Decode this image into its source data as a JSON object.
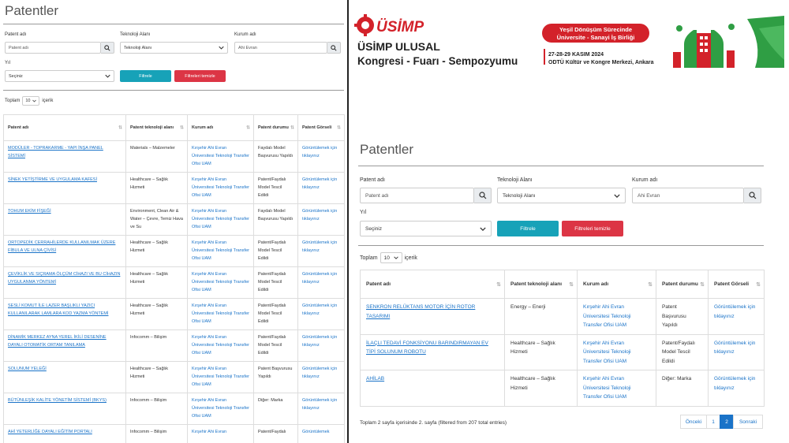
{
  "page": {
    "title": "Patentler"
  },
  "filters": {
    "patent_label": "Patent adı",
    "patent_placeholder": "Patent adı",
    "tech_label": "Teknoloji Alanı",
    "tech_value": "Teknoloji Alanı",
    "kurum_label": "Kurum adı",
    "kurum_value": "Ahi Evran",
    "year_label": "Yıl",
    "year_value": "Seçiniz",
    "filter_button": "Filtrele",
    "clear_button": "Filtreleri temizle"
  },
  "toplam": {
    "prefix": "Toplam",
    "value": "10",
    "suffix": "içerik"
  },
  "table": {
    "headers": [
      "Patent adı",
      "Patent teknoloji alanı",
      "Kurum adı",
      "Patent durumu",
      "Patent Görseli"
    ]
  },
  "left_rows": [
    {
      "name": "MODÜLER - TOPRAKARME - YAPI İNŞA PANEL SİSTEMİ",
      "tech": "Materials – Malzemeler",
      "org": "Kırşehir Ahi Evran Üniversitesi Teknoloji Transfer Ofisi UAM",
      "status": "Faydalı Model Başvurusu Yapıldı",
      "image": "Görüntülemek için tıklayınız"
    },
    {
      "name": "SİNEK YETİŞTİRME VE UYGULAMA KAFESİ",
      "tech": "Healthcare – Sağlık Hizmeti",
      "org": "Kırşehir Ahi Evran Üniversitesi Teknoloji Transfer Ofisi UAM",
      "status": "Patent/Faydalı Model Tescil Edildi",
      "image": "Görüntülemek için tıklayınız"
    },
    {
      "name": "TOHUM EKİM FİŞEĞİ",
      "tech": "Environment, Clean Air & Water – Çevre, Temiz Hava ve Su",
      "org": "Kırşehir Ahi Evran Üniversitesi Teknoloji Transfer Ofisi UAM",
      "status": "Faydalı Model Başvurusu Yapıldı",
      "image": "Görüntülemek için tıklayınız"
    },
    {
      "name": "ORTOPEDİK CERRAHİLERDE KULLANILMAK ÜZERE FİBULA VE ULNA ÇİVİSİ",
      "tech": "Healthcare – Sağlık Hizmeti",
      "org": "Kırşehir Ahi Evran Üniversitesi Teknoloji Transfer Ofisi UAM",
      "status": "Patent/Faydalı Model Tescil Edildi",
      "image": "Görüntülemek için tıklayınız"
    },
    {
      "name": "ÇEVİKLİK VE SIÇRAMA ÖLÇÜM CİHAZI VE BU CİHAZIN UYGULANMA YÖNTEMİ",
      "tech": "Healthcare – Sağlık Hizmeti",
      "org": "Kırşehir Ahi Evran Üniversitesi Teknoloji Transfer Ofisi UAM",
      "status": "Patent/Faydalı Model Tescil Edildi",
      "image": "Görüntülemek için tıklayınız"
    },
    {
      "name": "SESLİ KOMUT İLE LAZER BAŞLIKLI YAZICI KULLANILARAK LAMLARA KOD YAZMA YÖNTEMİ",
      "tech": "Healthcare – Sağlık Hizmeti",
      "org": "Kırşehir Ahi Evran Üniversitesi Teknoloji Transfer Ofisi UAM",
      "status": "Patent/Faydalı Model Tescil Edildi",
      "image": "Görüntülemek için tıklayınız"
    },
    {
      "name": "DİNAMİK MERKEZ AYNA YEREL İKİLİ DESENİNE DAYALI OTOMATİK ORTAM TANILAMA",
      "tech": "Infocomm – Bilişim",
      "org": "Kırşehir Ahi Evran Üniversitesi Teknoloji Transfer Ofisi UAM",
      "status": "Patent/Faydalı Model Tescil Edildi",
      "image": "Görüntülemek için tıklayınız"
    },
    {
      "name": "SOLUNUM YELEĞİ",
      "tech": "Healthcare – Sağlık Hizmeti",
      "org": "Kırşehir Ahi Evran Üniversitesi Teknoloji Transfer Ofisi UAM",
      "status": "Patent Başvurusu Yapıldı",
      "image": "Görüntülemek için tıklayınız"
    },
    {
      "name": "BÜTÜNLEŞİK KALİTE YÖNETİM SİSTEMİ (BKYS)",
      "tech": "Infocomm – Bilişim",
      "org": "Kırşehir Ahi Evran Üniversitesi Teknoloji Transfer Ofisi UAM",
      "status": "Diğer: Marka",
      "image": "Görüntülemek için tıklayınız"
    },
    {
      "name": "AHİ YETERLİĞE DAYALI EĞİTİM PORTALI",
      "tech": "Infocomm – Bilişim",
      "org": "Kırşehir Ahi Evran",
      "status": "Patent/Faydalı",
      "image": "Görüntülemek"
    }
  ],
  "right_rows": [
    {
      "name": "SENKRON RELÜKTANS MOTOR İÇİN ROTOR TASARIMI",
      "tech": "Energy – Enerji",
      "org": "Kırşehir Ahi Evran Üniversitesi Teknoloji Transfer Ofisi UAM",
      "status": "Patent Başvurusu Yapıldı",
      "image": "Görüntülemek için tıklayınız"
    },
    {
      "name": "İLAÇLI TEDAVİ FONKSİYONU BARINDIRMAYAN EV TİPİ SOLUNUM ROBOTU",
      "tech": "Healthcare – Sağlık Hizmeti",
      "org": "Kırşehir Ahi Evran Üniversitesi Teknoloji Transfer Ofisi UAM",
      "status": "Patent/Faydalı Model Tescil Edildi",
      "image": "Görüntülemek için tıklayınız"
    },
    {
      "name": "AHİLAB",
      "tech": "Healthcare – Sağlık Hizmeti",
      "org": "Kırşehir Ahi Evran Üniversitesi Teknoloji Transfer Ofisi UAM",
      "status": "Diğer: Marka",
      "image": "Görüntülemek için tıklayınız"
    }
  ],
  "footer": {
    "info": "Toplam 2 sayfa içerisinde 2. sayfa (filtered from 207 total entries)",
    "prev": "Önceki",
    "page1": "1",
    "page2": "2",
    "next": "Sonraki"
  },
  "banner": {
    "logo": "ÜSİMP",
    "title1": "ÜSİMP ULUSAL",
    "title2": "Kongresi - Fuarı - Sempozyumu",
    "slogan1": "Yeşil Dönüşüm Sürecinde",
    "slogan2": "Üniversite - Sanayi İş Birliği",
    "date": "27-28-29 KASIM 2024",
    "venue": "ODTÜ Kültür ve Kongre Merkezi, Ankara",
    "colors": {
      "red": "#d3222a",
      "green": "#2f9e44",
      "dark": "#222222"
    }
  }
}
